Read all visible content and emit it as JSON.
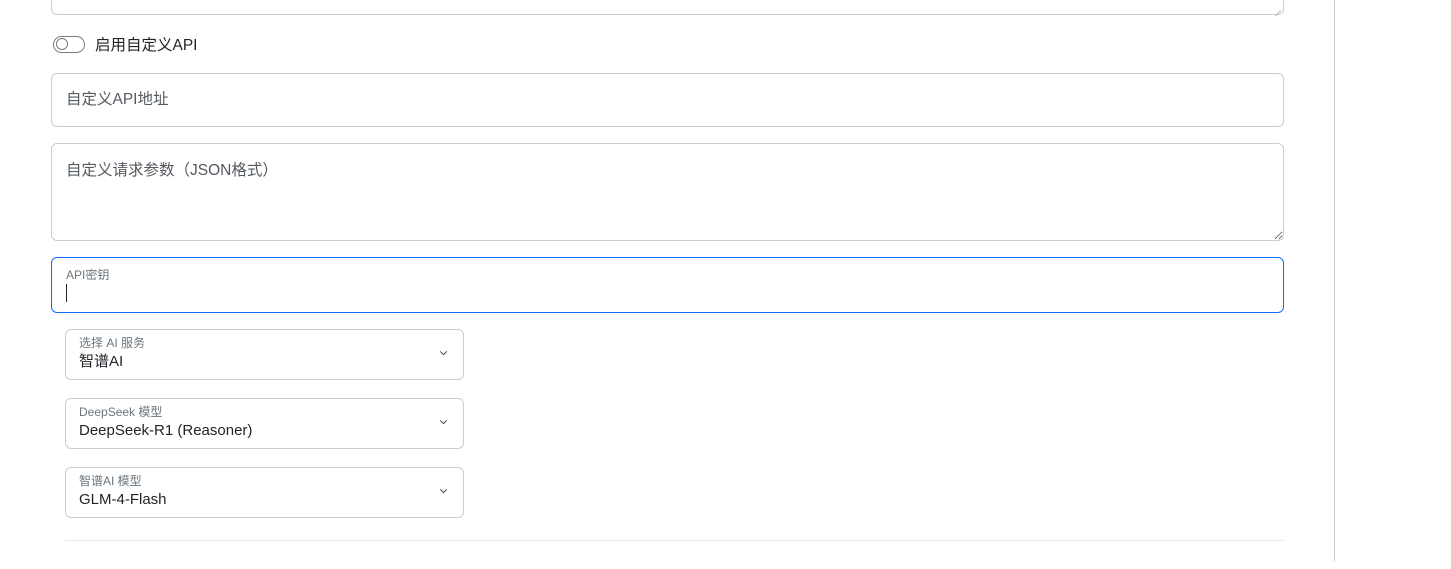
{
  "toggle": {
    "enabled": false,
    "label": "启用自定义API"
  },
  "inputs": {
    "custom_api_url": {
      "placeholder": "自定义API地址",
      "value": ""
    },
    "custom_params": {
      "placeholder": "自定义请求参数（JSON格式）",
      "value": ""
    },
    "api_key": {
      "label": "API密钥",
      "value": ""
    }
  },
  "selects": {
    "ai_service": {
      "label": "选择 AI 服务",
      "value": "智谱AI"
    },
    "deepseek_model": {
      "label": "DeepSeek 模型",
      "value": "DeepSeek-R1 (Reasoner)"
    },
    "zhipu_model": {
      "label": "智谱AI 模型",
      "value": "GLM-4-Flash"
    }
  }
}
